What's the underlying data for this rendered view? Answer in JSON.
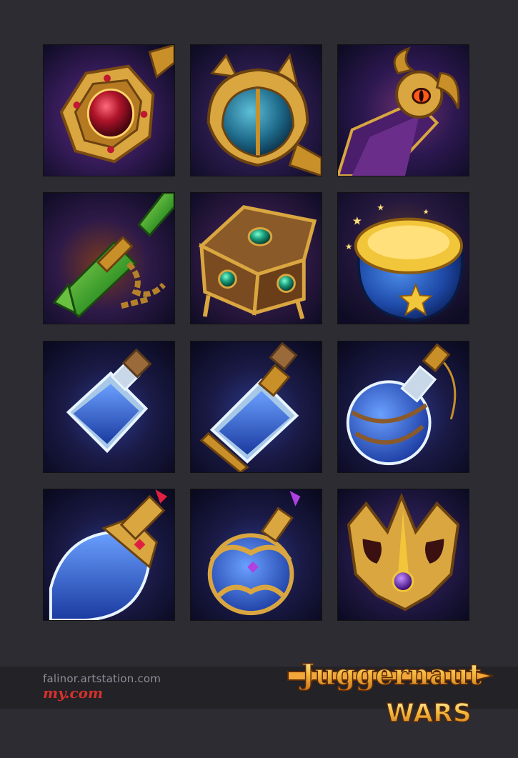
{
  "grid": {
    "items": [
      {
        "icon": "ruby-amulet-icon",
        "bg": "#3a1d5e"
      },
      {
        "icon": "scarab-helmet-icon",
        "bg": "#2a1b4c"
      },
      {
        "icon": "horned-staff-icon",
        "bg": "#2c1850"
      },
      {
        "icon": "emerald-flail-icon",
        "bg": "#2e1a48"
      },
      {
        "icon": "gem-chest-icon",
        "bg": "#301a44"
      },
      {
        "icon": "star-coin-pouch-icon",
        "bg": "#25183e"
      },
      {
        "icon": "small-mana-potion-icon",
        "bg": "#1a1a46"
      },
      {
        "icon": "medium-mana-potion-icon",
        "bg": "#1a1a46"
      },
      {
        "icon": "round-mana-potion-icon",
        "bg": "#1a1a46"
      },
      {
        "icon": "large-mana-flask-icon",
        "bg": "#1a1a46"
      },
      {
        "icon": "ornate-mana-vase-icon",
        "bg": "#1a1a46"
      },
      {
        "icon": "golden-crown-crest-icon",
        "bg": "#241a48"
      }
    ]
  },
  "footer": {
    "credit": "falinor.artstation.com",
    "brand": "my.com",
    "logo_line1": "Juggernaut",
    "logo_line2": "WARS"
  },
  "colors": {
    "background": "#2d2c33",
    "gold": "#e8b43c",
    "mana_blue": "#2f6fd8",
    "brand_red": "#d4322b"
  }
}
